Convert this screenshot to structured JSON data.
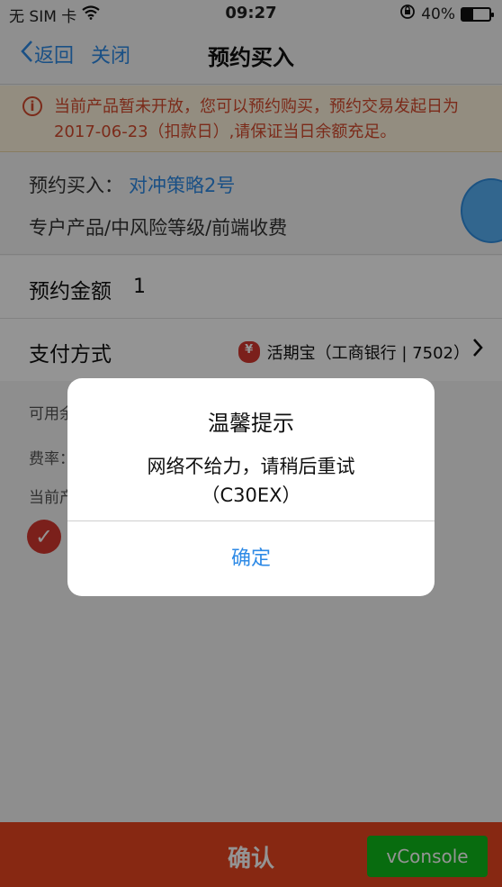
{
  "status_bar": {
    "carrier": "无 SIM 卡",
    "wifi_icon": "wifi-icon",
    "time": "09:27",
    "lock_icon": "rotation-lock-icon",
    "battery_percent": "40%",
    "battery_level": 0.4
  },
  "nav": {
    "back_label": "返回",
    "close_label": "关闭",
    "title": "预约买入"
  },
  "notice": {
    "icon": "info-icon",
    "text": "当前产品暂未开放，您可以预约购买，预约交易发起日为2017-06-23（扣款日）,请保证当日余额充足。"
  },
  "product": {
    "label": "预约买入：",
    "name": "对冲策略2号",
    "attributes": "专户产品/中风险等级/前端收费"
  },
  "amount": {
    "label": "预约金额",
    "value": "1"
  },
  "payment": {
    "label": "支付方式",
    "icon": "money-bag-icon",
    "method": "活期宝（工商银行 | 7502）"
  },
  "info": {
    "available": "可用余",
    "fee_rate": "费率：",
    "current": "当前产"
  },
  "footer": {
    "confirm_label": "确认",
    "vconsole_label": "vConsole"
  },
  "dialog": {
    "title": "温馨提示",
    "message_line1": "网络不给力，请稍后重试",
    "message_line2": "（C30EX）",
    "ok_label": "确定"
  },
  "colors": {
    "accent_blue": "#2e8ae6",
    "alert_red": "#d54a2e",
    "confirm_orange": "#e8461f",
    "vconsole_green": "#0fbb1b"
  }
}
